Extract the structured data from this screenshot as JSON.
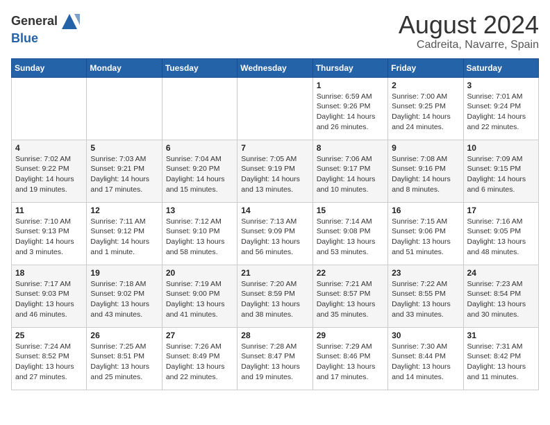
{
  "header": {
    "logo_line1": "General",
    "logo_line2": "Blue",
    "month_year": "August 2024",
    "location": "Cadreita, Navarre, Spain"
  },
  "weekdays": [
    "Sunday",
    "Monday",
    "Tuesday",
    "Wednesday",
    "Thursday",
    "Friday",
    "Saturday"
  ],
  "weeks": [
    [
      {
        "day": "",
        "info": ""
      },
      {
        "day": "",
        "info": ""
      },
      {
        "day": "",
        "info": ""
      },
      {
        "day": "",
        "info": ""
      },
      {
        "day": "1",
        "info": "Sunrise: 6:59 AM\nSunset: 9:26 PM\nDaylight: 14 hours\nand 26 minutes."
      },
      {
        "day": "2",
        "info": "Sunrise: 7:00 AM\nSunset: 9:25 PM\nDaylight: 14 hours\nand 24 minutes."
      },
      {
        "day": "3",
        "info": "Sunrise: 7:01 AM\nSunset: 9:24 PM\nDaylight: 14 hours\nand 22 minutes."
      }
    ],
    [
      {
        "day": "4",
        "info": "Sunrise: 7:02 AM\nSunset: 9:22 PM\nDaylight: 14 hours\nand 19 minutes."
      },
      {
        "day": "5",
        "info": "Sunrise: 7:03 AM\nSunset: 9:21 PM\nDaylight: 14 hours\nand 17 minutes."
      },
      {
        "day": "6",
        "info": "Sunrise: 7:04 AM\nSunset: 9:20 PM\nDaylight: 14 hours\nand 15 minutes."
      },
      {
        "day": "7",
        "info": "Sunrise: 7:05 AM\nSunset: 9:19 PM\nDaylight: 14 hours\nand 13 minutes."
      },
      {
        "day": "8",
        "info": "Sunrise: 7:06 AM\nSunset: 9:17 PM\nDaylight: 14 hours\nand 10 minutes."
      },
      {
        "day": "9",
        "info": "Sunrise: 7:08 AM\nSunset: 9:16 PM\nDaylight: 14 hours\nand 8 minutes."
      },
      {
        "day": "10",
        "info": "Sunrise: 7:09 AM\nSunset: 9:15 PM\nDaylight: 14 hours\nand 6 minutes."
      }
    ],
    [
      {
        "day": "11",
        "info": "Sunrise: 7:10 AM\nSunset: 9:13 PM\nDaylight: 14 hours\nand 3 minutes."
      },
      {
        "day": "12",
        "info": "Sunrise: 7:11 AM\nSunset: 9:12 PM\nDaylight: 14 hours\nand 1 minute."
      },
      {
        "day": "13",
        "info": "Sunrise: 7:12 AM\nSunset: 9:10 PM\nDaylight: 13 hours\nand 58 minutes."
      },
      {
        "day": "14",
        "info": "Sunrise: 7:13 AM\nSunset: 9:09 PM\nDaylight: 13 hours\nand 56 minutes."
      },
      {
        "day": "15",
        "info": "Sunrise: 7:14 AM\nSunset: 9:08 PM\nDaylight: 13 hours\nand 53 minutes."
      },
      {
        "day": "16",
        "info": "Sunrise: 7:15 AM\nSunset: 9:06 PM\nDaylight: 13 hours\nand 51 minutes."
      },
      {
        "day": "17",
        "info": "Sunrise: 7:16 AM\nSunset: 9:05 PM\nDaylight: 13 hours\nand 48 minutes."
      }
    ],
    [
      {
        "day": "18",
        "info": "Sunrise: 7:17 AM\nSunset: 9:03 PM\nDaylight: 13 hours\nand 46 minutes."
      },
      {
        "day": "19",
        "info": "Sunrise: 7:18 AM\nSunset: 9:02 PM\nDaylight: 13 hours\nand 43 minutes."
      },
      {
        "day": "20",
        "info": "Sunrise: 7:19 AM\nSunset: 9:00 PM\nDaylight: 13 hours\nand 41 minutes."
      },
      {
        "day": "21",
        "info": "Sunrise: 7:20 AM\nSunset: 8:59 PM\nDaylight: 13 hours\nand 38 minutes."
      },
      {
        "day": "22",
        "info": "Sunrise: 7:21 AM\nSunset: 8:57 PM\nDaylight: 13 hours\nand 35 minutes."
      },
      {
        "day": "23",
        "info": "Sunrise: 7:22 AM\nSunset: 8:55 PM\nDaylight: 13 hours\nand 33 minutes."
      },
      {
        "day": "24",
        "info": "Sunrise: 7:23 AM\nSunset: 8:54 PM\nDaylight: 13 hours\nand 30 minutes."
      }
    ],
    [
      {
        "day": "25",
        "info": "Sunrise: 7:24 AM\nSunset: 8:52 PM\nDaylight: 13 hours\nand 27 minutes."
      },
      {
        "day": "26",
        "info": "Sunrise: 7:25 AM\nSunset: 8:51 PM\nDaylight: 13 hours\nand 25 minutes."
      },
      {
        "day": "27",
        "info": "Sunrise: 7:26 AM\nSunset: 8:49 PM\nDaylight: 13 hours\nand 22 minutes."
      },
      {
        "day": "28",
        "info": "Sunrise: 7:28 AM\nSunset: 8:47 PM\nDaylight: 13 hours\nand 19 minutes."
      },
      {
        "day": "29",
        "info": "Sunrise: 7:29 AM\nSunset: 8:46 PM\nDaylight: 13 hours\nand 17 minutes."
      },
      {
        "day": "30",
        "info": "Sunrise: 7:30 AM\nSunset: 8:44 PM\nDaylight: 13 hours\nand 14 minutes."
      },
      {
        "day": "31",
        "info": "Sunrise: 7:31 AM\nSunset: 8:42 PM\nDaylight: 13 hours\nand 11 minutes."
      }
    ]
  ]
}
